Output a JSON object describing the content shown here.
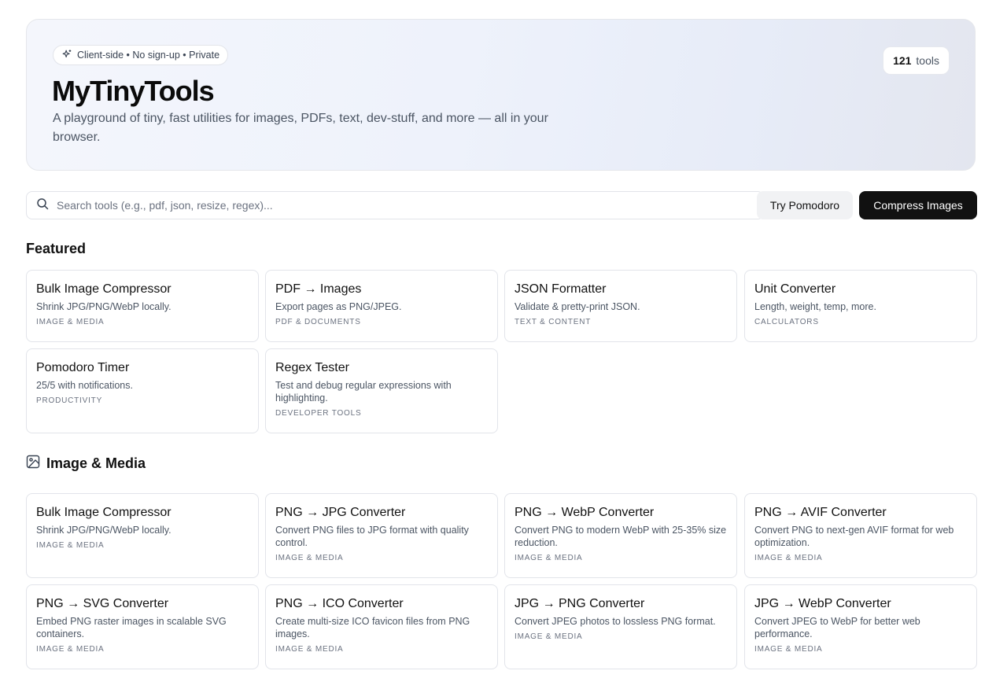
{
  "hero": {
    "pill": "Client-side • No sign-up • Private",
    "title": "MyTinyTools",
    "subtitle": "A playground of tiny, fast utilities for images, PDFs, text, dev-stuff, and more — all in your browser.",
    "tools_count": "121",
    "tools_label": "tools"
  },
  "search": {
    "placeholder": "Search tools (e.g., pdf, json, resize, regex)..."
  },
  "actions": {
    "pomodoro": "Try Pomodoro",
    "compress": "Compress Images"
  },
  "featured": {
    "title": "Featured",
    "cards": [
      {
        "title": "Bulk Image Compressor",
        "desc": "Shrink JPG/PNG/WebP locally.",
        "category": "IMAGE & MEDIA"
      },
      {
        "title": "PDF → Images",
        "desc": "Export pages as PNG/JPEG.",
        "category": "PDF & DOCUMENTS"
      },
      {
        "title": "JSON Formatter",
        "desc": "Validate & pretty-print JSON.",
        "category": "TEXT & CONTENT"
      },
      {
        "title": "Unit Converter",
        "desc": "Length, weight, temp, more.",
        "category": "CALCULATORS"
      },
      {
        "title": "Pomodoro Timer",
        "desc": "25/5 with notifications.",
        "category": "PRODUCTIVITY"
      },
      {
        "title": "Regex Tester",
        "desc": "Test and debug regular expressions with highlighting.",
        "category": "DEVELOPER TOOLS"
      }
    ]
  },
  "image_media": {
    "title": "Image & Media",
    "icon": "image-icon",
    "cards": [
      {
        "title": "Bulk Image Compressor",
        "desc": "Shrink JPG/PNG/WebP locally.",
        "category": "IMAGE & MEDIA"
      },
      {
        "title": "PNG → JPG Converter",
        "desc": "Convert PNG files to JPG format with quality control.",
        "category": "IMAGE & MEDIA"
      },
      {
        "title": "PNG → WebP Converter",
        "desc": "Convert PNG to modern WebP with 25-35% size reduction.",
        "category": "IMAGE & MEDIA"
      },
      {
        "title": "PNG → AVIF Converter",
        "desc": "Convert PNG to next-gen AVIF format for web optimization.",
        "category": "IMAGE & MEDIA"
      },
      {
        "title": "PNG → SVG Converter",
        "desc": "Embed PNG raster images in scalable SVG containers.",
        "category": "IMAGE & MEDIA"
      },
      {
        "title": "PNG → ICO Converter",
        "desc": "Create multi-size ICO favicon files from PNG images.",
        "category": "IMAGE & MEDIA"
      },
      {
        "title": "JPG → PNG Converter",
        "desc": "Convert JPEG photos to lossless PNG format.",
        "category": "IMAGE & MEDIA"
      },
      {
        "title": "JPG → WebP Converter",
        "desc": "Convert JPEG to WebP for better web performance.",
        "category": "IMAGE & MEDIA"
      }
    ]
  }
}
